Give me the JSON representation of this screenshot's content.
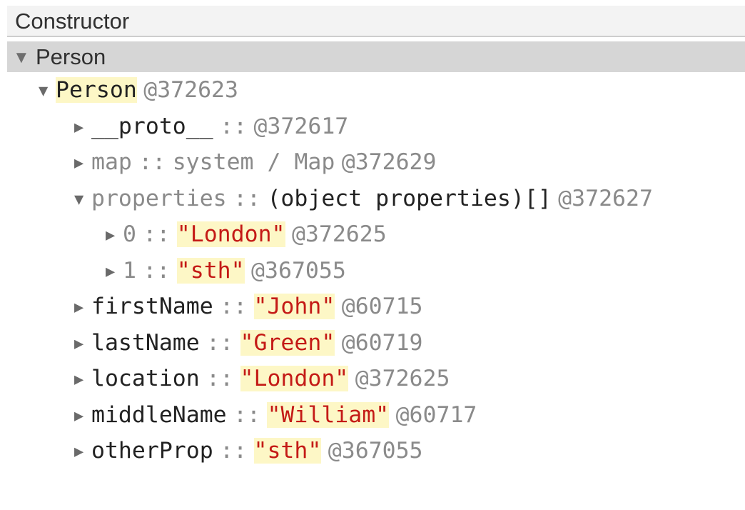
{
  "header": {
    "title": "Constructor"
  },
  "class_row": {
    "label": "Person"
  },
  "root": {
    "name": "Person",
    "address": "@372623"
  },
  "children": [
    {
      "name": "__proto__",
      "sep": "::",
      "type": "",
      "value": "",
      "address": "@372617",
      "expanded": false,
      "name_dim": false
    },
    {
      "name": "map",
      "sep": "::",
      "type": "system / Map",
      "value": "",
      "address": "@372629",
      "expanded": false,
      "name_dim": true
    },
    {
      "name": "properties",
      "sep": "::",
      "type": "(object properties)[]",
      "value": "",
      "address": "@372627",
      "expanded": true,
      "name_dim": true,
      "children": [
        {
          "name": "0",
          "sep": "::",
          "value": "\"London\"",
          "address": "@372625"
        },
        {
          "name": "1",
          "sep": "::",
          "value": "\"sth\"",
          "address": "@367055"
        }
      ]
    },
    {
      "name": "firstName",
      "sep": "::",
      "value": "\"John\"",
      "address": "@60715",
      "expanded": false
    },
    {
      "name": "lastName",
      "sep": "::",
      "value": "\"Green\"",
      "address": "@60719",
      "expanded": false
    },
    {
      "name": "location",
      "sep": "::",
      "value": "\"London\"",
      "address": "@372625",
      "expanded": false
    },
    {
      "name": "middleName",
      "sep": "::",
      "value": "\"William\"",
      "address": "@60717",
      "expanded": false
    },
    {
      "name": "otherProp",
      "sep": "::",
      "value": "\"sth\"",
      "address": "@367055",
      "expanded": false
    }
  ],
  "icons": {
    "expanded": "triangle-down-icon",
    "collapsed": "triangle-right-icon"
  },
  "colors": {
    "string": "#c41a16",
    "highlight": "#fdf7c6",
    "dim": "#8a8a8a",
    "selected_row": "#d6d6d6"
  }
}
